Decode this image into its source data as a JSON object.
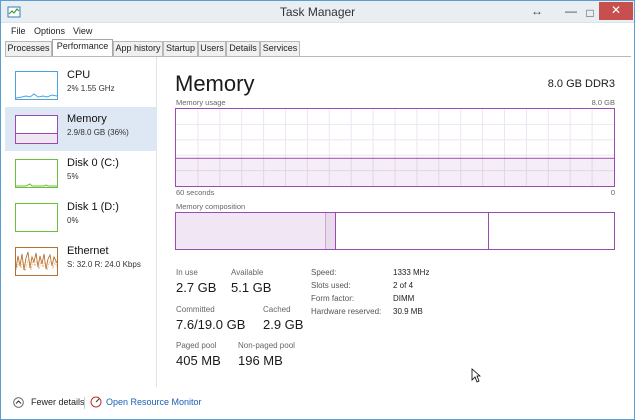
{
  "window": {
    "title": "Task Manager",
    "resize_glyph": "↔",
    "minimize_glyph": "—",
    "maximize_glyph": "□",
    "close_glyph": "✕"
  },
  "menu": [
    "File",
    "Options",
    "View"
  ],
  "tabs": [
    "Processes",
    "Performance",
    "App history",
    "Startup",
    "Users",
    "Details",
    "Services"
  ],
  "devices": [
    {
      "name": "CPU",
      "value": "2%  1.55 GHz",
      "color": "#4aa3dc"
    },
    {
      "name": "Memory",
      "value": "2.9/8.0 GB (36%)",
      "color": "#9b4bb0"
    },
    {
      "name": "Disk 0 (C:)",
      "value": "5%",
      "color": "#6cbf3c"
    },
    {
      "name": "Disk 1 (D:)",
      "value": "0%",
      "color": "#6cbf3c"
    },
    {
      "name": "Ethernet",
      "value": "S: 32.0  R: 24.0 Kbps",
      "color": "#b8702e"
    }
  ],
  "main": {
    "title": "Memory",
    "spec": "8.0 GB DDR3",
    "usage_label": "Memory usage",
    "usage_max": "8.0 GB",
    "time_left": "60 seconds",
    "time_right": "0",
    "composition_label": "Memory composition",
    "usage_fraction": 0.36
  },
  "stats": {
    "in_use_label": "In use",
    "in_use": "2.7 GB",
    "available_label": "Available",
    "available": "5.1 GB",
    "committed_label": "Committed",
    "committed": "7.6/19.0 GB",
    "cached_label": "Cached",
    "cached": "2.9 GB",
    "paged_label": "Paged pool",
    "paged": "405 MB",
    "nonpaged_label": "Non-paged pool",
    "nonpaged": "196 MB"
  },
  "details": {
    "speed_label": "Speed:",
    "speed": "1333 MHz",
    "slots_label": "Slots used:",
    "slots": "2 of 4",
    "form_label": "Form factor:",
    "form": "DIMM",
    "reserved_label": "Hardware reserved:",
    "reserved": "30.9 MB"
  },
  "footer": {
    "fewer": "Fewer details",
    "resmon": "Open Resource Monitor"
  },
  "colors": {
    "accent": "#9b4bb0",
    "link": "#1a5fb4"
  }
}
